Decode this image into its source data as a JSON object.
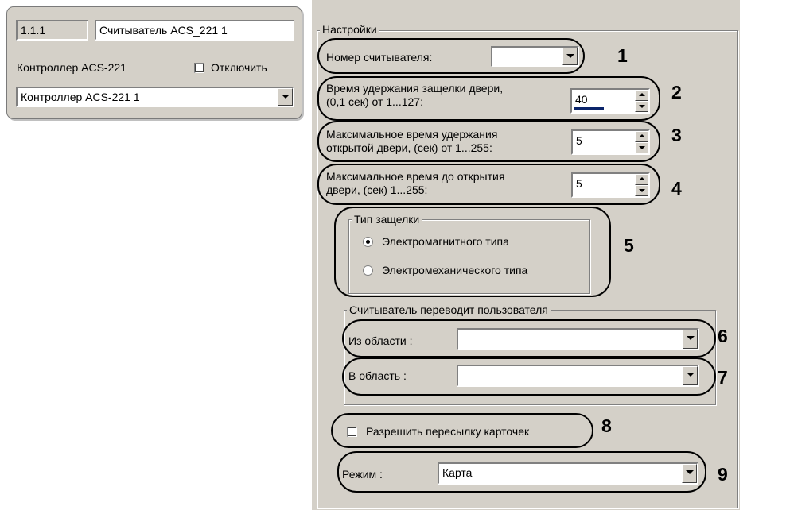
{
  "object_panel": {
    "id": "1.1.1",
    "name": "Считыватель ACS_221 1",
    "parent_label": "Контроллер ACS-221",
    "disable_label": "Отключить",
    "disable_checked": false,
    "parent_value": "Контроллер ACS-221 1"
  },
  "settings": {
    "title": "Настройки",
    "reader_number_label": "Номер считывателя:",
    "reader_number_value": "",
    "lock_hold_label_line1": "Время удержания защелки двери,",
    "lock_hold_label_line2": "(0,1 сек) от 1...127:",
    "lock_hold_value": "40",
    "max_open_label_line1": "Максимальное время удержания",
    "max_open_label_line2": "открытой двери, (сек) от 1...255:",
    "max_open_value": "5",
    "max_to_open_label_line1": "Максимальное время до открытия",
    "max_to_open_label_line2": "двери, (сек) 1...255:",
    "max_to_open_value": "5",
    "lock_type": {
      "title": "Тип защелки",
      "options": [
        "Электромагнитного типа",
        "Электромеханического типа"
      ],
      "selected": 0
    },
    "transfer_group": {
      "title": "Считыватель переводит пользователя",
      "from_label": "Из области :",
      "from_value": "",
      "to_label": "В область :",
      "to_value": ""
    },
    "allow_card_forwarding_label": "Разрешить пересылку карточек",
    "allow_card_forwarding_checked": false,
    "mode_label": "Режим :",
    "mode_value": "Карта"
  },
  "callouts": [
    "1",
    "2",
    "3",
    "4",
    "5",
    "6",
    "7",
    "8",
    "9"
  ],
  "colors": {
    "panel": "#d4d0c8",
    "progress": "#0a246a"
  }
}
